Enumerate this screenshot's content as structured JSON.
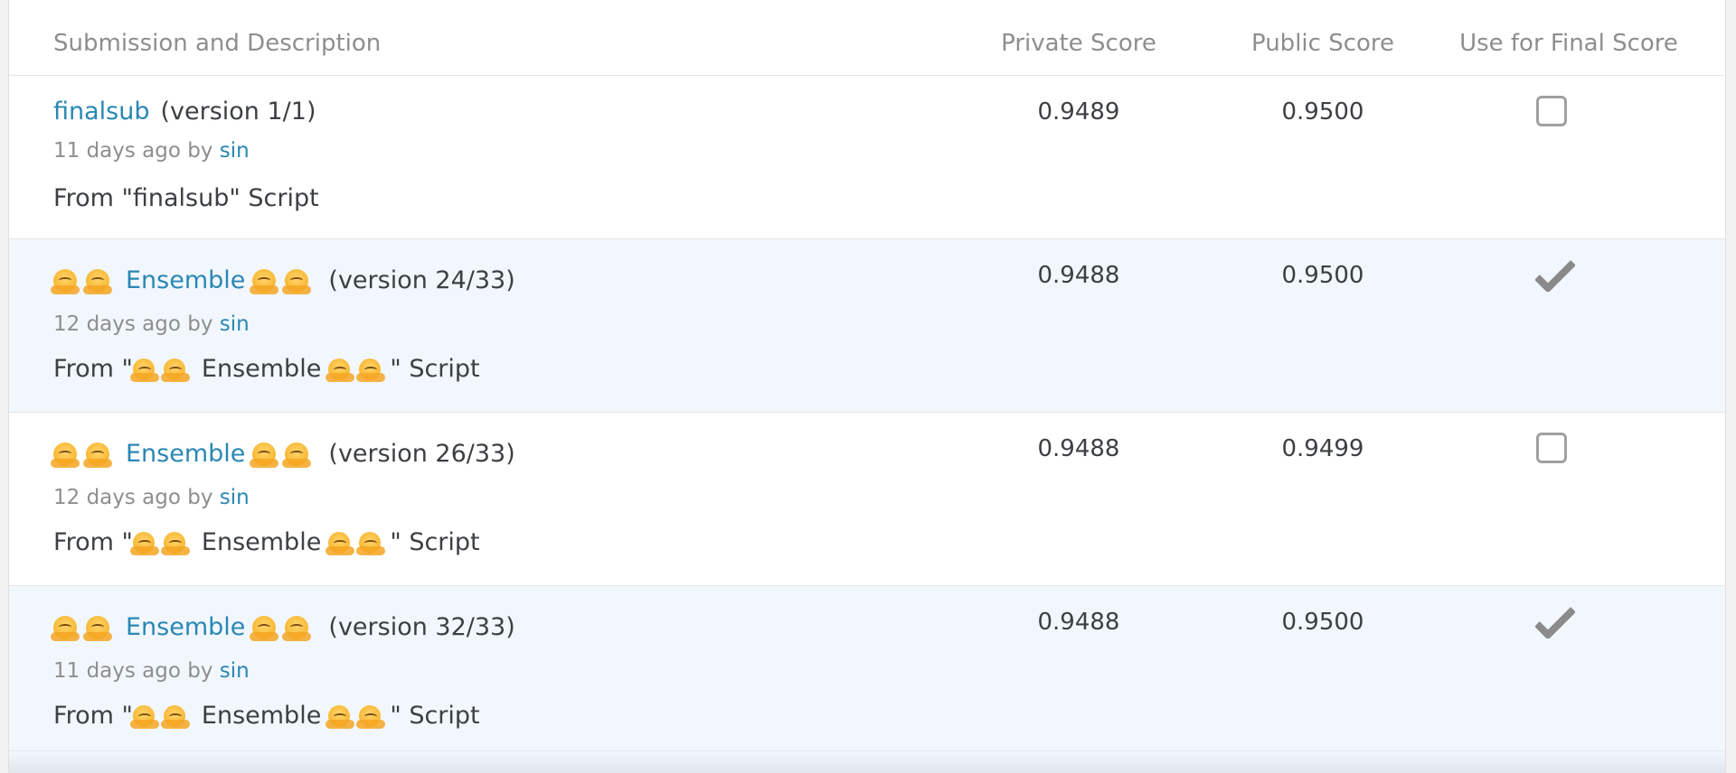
{
  "header": {
    "submission": "Submission and Description",
    "private_score": "Private Score",
    "public_score": "Public Score",
    "use_final": "Use for Final Score"
  },
  "rows": [
    {
      "name": "finalsub",
      "version": "(version 1/1)",
      "age": "11 days ago by",
      "user": "sin",
      "desc_prefix": "From \"finalsub\" Script",
      "private": "0.9489",
      "public": "0.9500",
      "selected": false
    },
    {
      "name": "Ensemble",
      "version": "(version 24/33)",
      "age": "12 days ago by",
      "user": "sin",
      "desc_prefix": "From \"",
      "desc_name": "Ensemble",
      "desc_suffix": "\" Script",
      "private": "0.9488",
      "public": "0.9500",
      "selected": true
    },
    {
      "name": "Ensemble",
      "version": "(version 26/33)",
      "age": "12 days ago by",
      "user": "sin",
      "desc_prefix": "From \"",
      "desc_name": "Ensemble",
      "desc_suffix": "\" Script",
      "private": "0.9488",
      "public": "0.9499",
      "selected": false
    },
    {
      "name": "Ensemble",
      "version": "(version 32/33)",
      "age": "11 days ago by",
      "user": "sin",
      "desc_prefix": "From \"",
      "desc_name": "Ensemble",
      "desc_suffix": "\" Script",
      "private": "0.9488",
      "public": "0.9500",
      "selected": true
    }
  ],
  "icons": {
    "emoji": "hugging-face-emoji",
    "checked": "checkmark-icon",
    "unchecked": "empty-checkbox-icon"
  },
  "colors": {
    "link": "#2a87b4",
    "selected_row_bg": "#f1f7fd",
    "muted_text": "#8e8e8e",
    "text": "#3c4043"
  }
}
